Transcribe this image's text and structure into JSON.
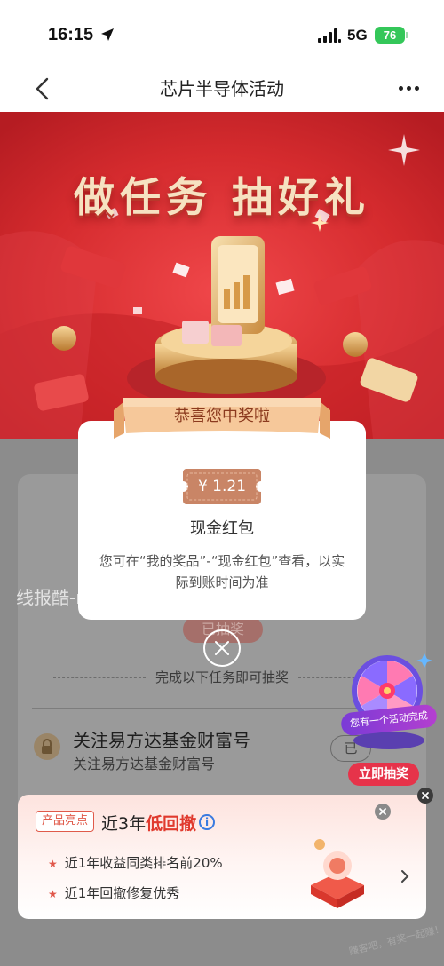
{
  "status_bar": {
    "time": "16:15",
    "network": "5G",
    "battery": "76"
  },
  "nav": {
    "title": "芯片半导体活动"
  },
  "banner": {
    "headline": "做任务 抽好礼"
  },
  "modal": {
    "ribbon": "恭喜您中奖啦",
    "amount": "¥ 1.21",
    "prize_name": "现金红包",
    "note": "您可在“我的奖品”-“现金红包”查看，以实际到账时间为准"
  },
  "watermark": "线报酷-new.xianbao.fun",
  "tasks": {
    "draw_button": "已抽奖",
    "hint": "完成以下任务即可抽奖",
    "items": [
      {
        "title": "关注易方达基金财富号",
        "subtitle": "关注易方达基金财富号",
        "action": "已"
      }
    ]
  },
  "wheel": {
    "caption": "您有一个活动完成",
    "cta": "立即抽奖"
  },
  "promo": {
    "badge": "产品亮点",
    "title_prefix": "近3年",
    "title_highlight": "低回撤",
    "points": [
      "近1年收益同类排名前20%",
      "近1年回撤修复优秀"
    ]
  },
  "corner_watermark": "赚客吧，有奖一起赚！www.zuanke8.com",
  "colors": {
    "accent_red": "#e03a2e",
    "banner_red": "#d42a2a",
    "gold": "#d8a04a",
    "battery_green": "#34c759"
  }
}
